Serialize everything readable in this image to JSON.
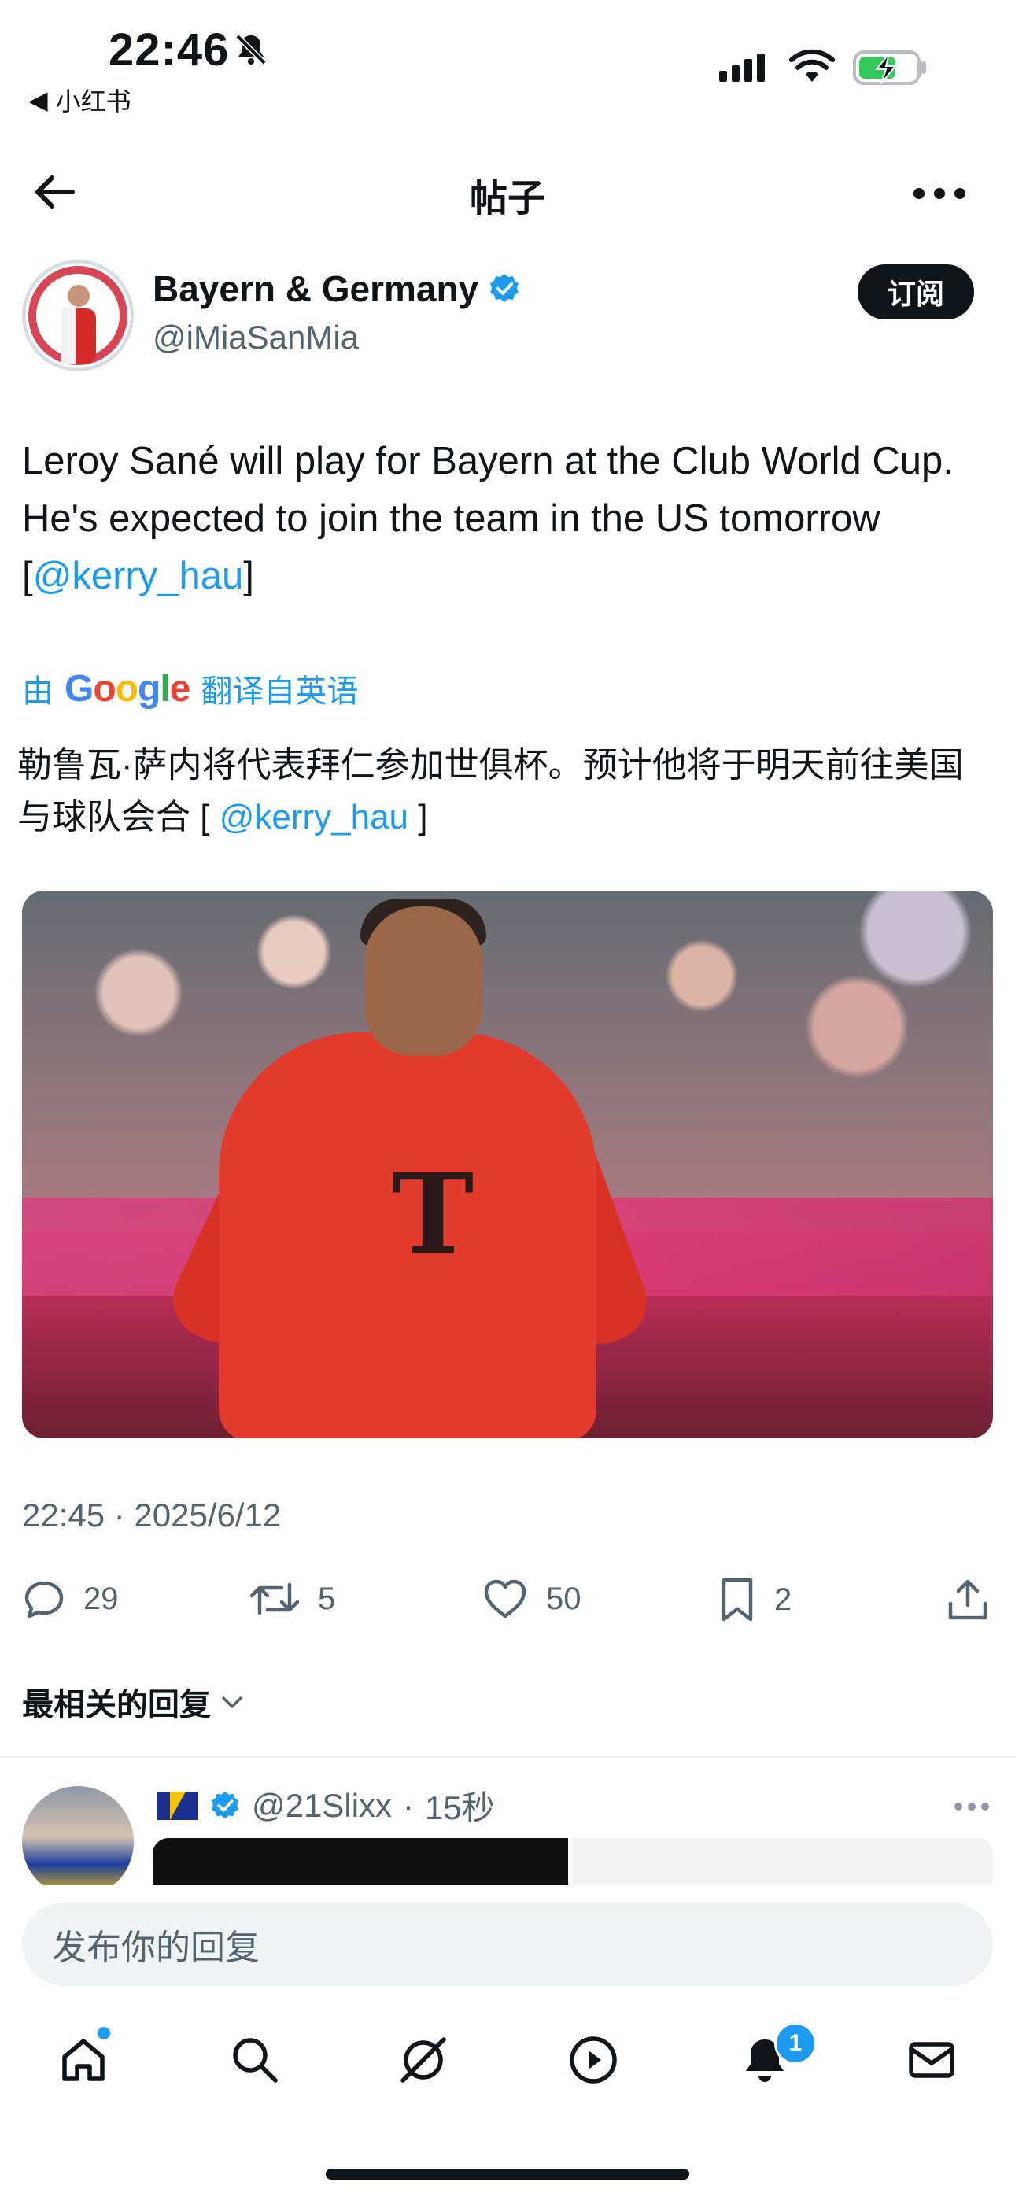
{
  "status_bar": {
    "time": "22:46",
    "back_app_label": "小红书"
  },
  "header": {
    "title": "帖子"
  },
  "post": {
    "author_name": "Bayern & Germany",
    "author_handle": "@iMiaSanMia",
    "subscribe_label": "订阅",
    "text_main": "Leroy Sané will play for Bayern at the Club World Cup. He's expected to join the team in the US tomorrow [",
    "mention": "@kerry_hau",
    "text_close": "]",
    "translate_prefix": "由",
    "translate_brand": "Google",
    "translate_suffix": "翻译自英语",
    "translated_main": "勒鲁瓦·萨内将代表拜仁参加世俱杯。预计他将于明天前往美国与球队会合 [ ",
    "translated_mention": "@kerry_hau",
    "translated_close": " ]",
    "timestamp": "22:45 · 2025/6/12"
  },
  "actions": {
    "replies": "29",
    "reposts": "5",
    "likes": "50",
    "bookmarks": "2"
  },
  "replies_section": {
    "sort_label": "最相关的回复",
    "first_reply_handle": "@21Slixx",
    "first_reply_time": "15秒"
  },
  "composer": {
    "placeholder": "发布你的回复"
  },
  "tab_bar": {
    "notification_count": "1"
  },
  "colors": {
    "accent": "#1d9bf0",
    "text": "#0f1419",
    "muted": "#536471"
  }
}
